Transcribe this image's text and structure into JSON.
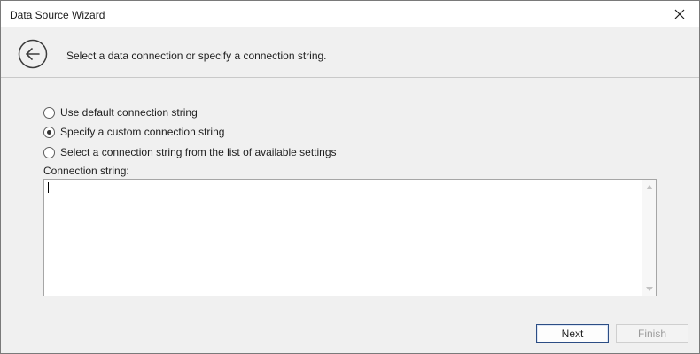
{
  "window": {
    "title": "Data Source Wizard",
    "close_icon": "close-icon"
  },
  "header": {
    "back_icon": "back-arrow-icon",
    "instruction": "Select a data connection or specify a connection string."
  },
  "options": [
    {
      "label": "Use default connection string",
      "checked": false
    },
    {
      "label": "Specify a custom connection string",
      "checked": true
    },
    {
      "label": "Select a connection string from the list of available settings",
      "checked": false
    }
  ],
  "connection_string": {
    "label": "Connection string:",
    "value": ""
  },
  "footer": {
    "next_label": "Next",
    "finish_label": "Finish",
    "finish_enabled": false
  },
  "colors": {
    "accent_border": "#2c4d84",
    "disabled_text": "#9a9a9a",
    "background": "#f0f0f0"
  }
}
